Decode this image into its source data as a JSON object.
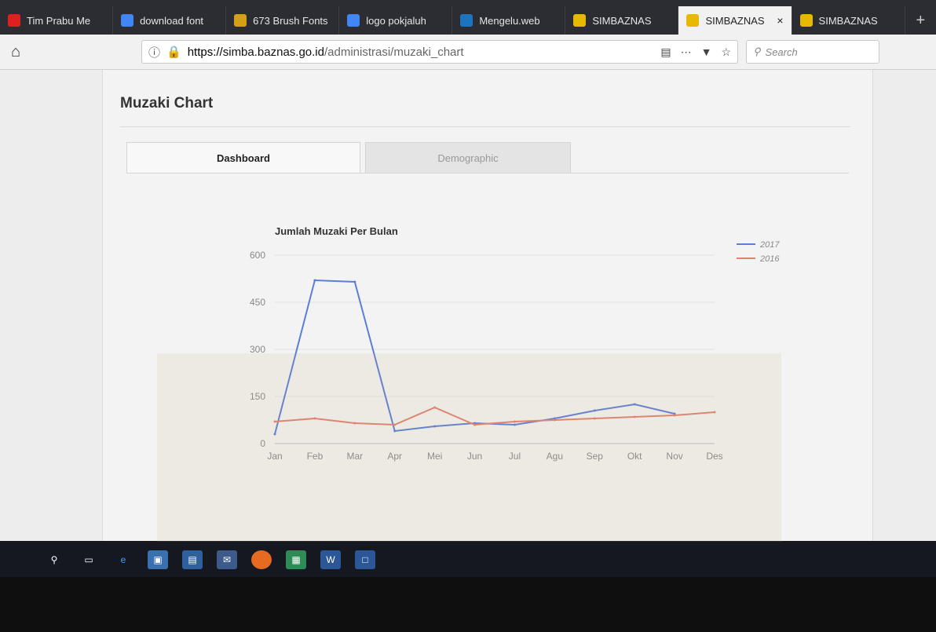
{
  "browser": {
    "tabs": [
      {
        "label": "Tim Prabu Me",
        "icon": "youtube-icon",
        "color": "#e02020"
      },
      {
        "label": "download font",
        "icon": "google-icon",
        "color": "#4285f4"
      },
      {
        "label": "673 Brush Fonts",
        "icon": "font-site-icon",
        "color": "#d4a017"
      },
      {
        "label": "logo pokjaluh",
        "icon": "google-icon",
        "color": "#4285f4"
      },
      {
        "label": "Mengelu.web",
        "icon": "site-icon",
        "color": "#1e73be"
      },
      {
        "label": "SIMBAZNAS",
        "icon": "simbaznas-icon",
        "color": "#e6b800"
      },
      {
        "label": "SIMBAZNAS",
        "icon": "simbaznas-icon",
        "color": "#e6b800",
        "active": true
      },
      {
        "label": "SIMBAZNAS",
        "icon": "simbaznas-icon",
        "color": "#e6b800"
      }
    ],
    "url": {
      "scheme": "https://",
      "host": "simba.baznas.go.id",
      "path": "/administrasi/muzaki_chart"
    },
    "search_placeholder": "Search"
  },
  "page": {
    "title": "Muzaki Chart",
    "tabs": [
      {
        "label": "Dashboard",
        "active": true
      },
      {
        "label": "Demographic",
        "active": false
      }
    ]
  },
  "chart_data": {
    "type": "line",
    "title": "Jumlah Muzaki Per Bulan",
    "categories": [
      "Jan",
      "Feb",
      "Mar",
      "Apr",
      "Mei",
      "Jun",
      "Jul",
      "Agu",
      "Sep",
      "Okt",
      "Nov",
      "Des"
    ],
    "series": [
      {
        "name": "2017",
        "color": "#5b7fd6",
        "values": [
          30,
          520,
          515,
          40,
          55,
          65,
          60,
          80,
          105,
          125,
          95,
          null
        ]
      },
      {
        "name": "2016",
        "color": "#e08070",
        "values": [
          70,
          80,
          65,
          60,
          115,
          60,
          70,
          75,
          80,
          85,
          90,
          100
        ]
      }
    ],
    "ylim": [
      0,
      600
    ],
    "yticks": [
      0,
      150,
      300,
      450,
      600
    ],
    "legend": "top-right",
    "grid": true
  }
}
